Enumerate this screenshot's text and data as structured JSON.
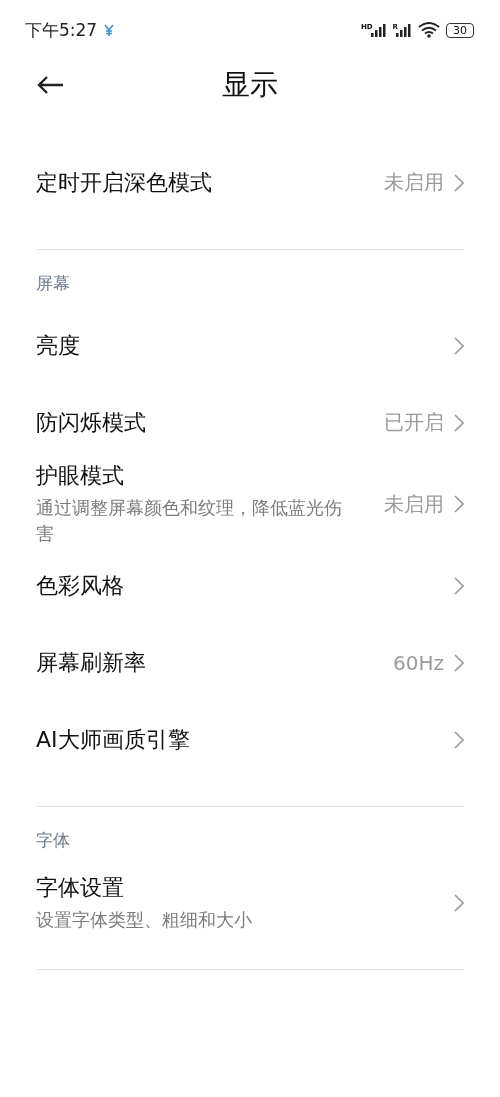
{
  "status_bar": {
    "time": "下午5:27",
    "signal_labels": [
      "HD",
      "R"
    ],
    "battery": "30"
  },
  "header": {
    "title": "显示"
  },
  "sections": [
    {
      "items": [
        {
          "title": "定时开启深色模式",
          "value": "未启用"
        }
      ]
    },
    {
      "header": "屏幕",
      "items": [
        {
          "title": "亮度"
        },
        {
          "title": "防闪烁模式",
          "value": "已开启"
        },
        {
          "title": "护眼模式",
          "subtitle": "通过调整屏幕颜色和纹理，降低蓝光伤害",
          "value": "未启用"
        },
        {
          "title": "色彩风格"
        },
        {
          "title": "屏幕刷新率",
          "value": "60Hz"
        },
        {
          "title": "AI大师画质引擎"
        }
      ]
    },
    {
      "header": "字体",
      "items": [
        {
          "title": "字体设置",
          "subtitle": "设置字体类型、粗细和大小"
        }
      ]
    }
  ]
}
